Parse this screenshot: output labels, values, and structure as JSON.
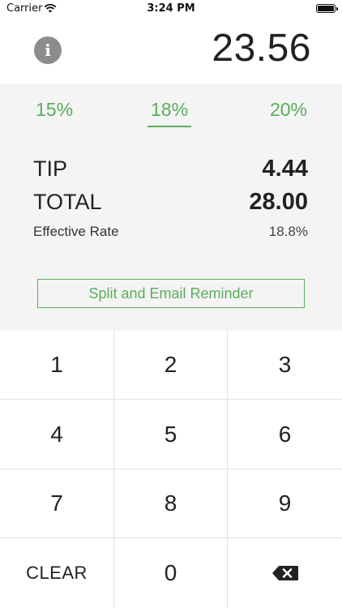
{
  "status_bar": {
    "carrier": "Carrier",
    "time": "3:24 PM",
    "wifi_icon": "wifi-icon",
    "battery_icon": "battery-icon"
  },
  "header": {
    "info_icon": "info-icon",
    "info_glyph": "i",
    "amount": "23.56"
  },
  "tip_options": [
    {
      "label": "15%",
      "selected": false
    },
    {
      "label": "18%",
      "selected": true
    },
    {
      "label": "20%",
      "selected": false
    }
  ],
  "summary": {
    "tip_label": "TIP",
    "tip_value": "4.44",
    "total_label": "TOTAL",
    "total_value": "28.00",
    "rate_label": "Effective Rate",
    "rate_value": "18.8%"
  },
  "split_button": {
    "label": "Split and Email Reminder"
  },
  "keypad": {
    "keys": [
      "1",
      "2",
      "3",
      "4",
      "5",
      "6",
      "7",
      "8",
      "9",
      "CLEAR",
      "0"
    ],
    "delete_icon": "backspace-icon"
  },
  "colors": {
    "accent": "#5aad5a",
    "panel_bg": "#f4f4f4",
    "info_bg": "#8c8c8c",
    "text": "#222222"
  }
}
